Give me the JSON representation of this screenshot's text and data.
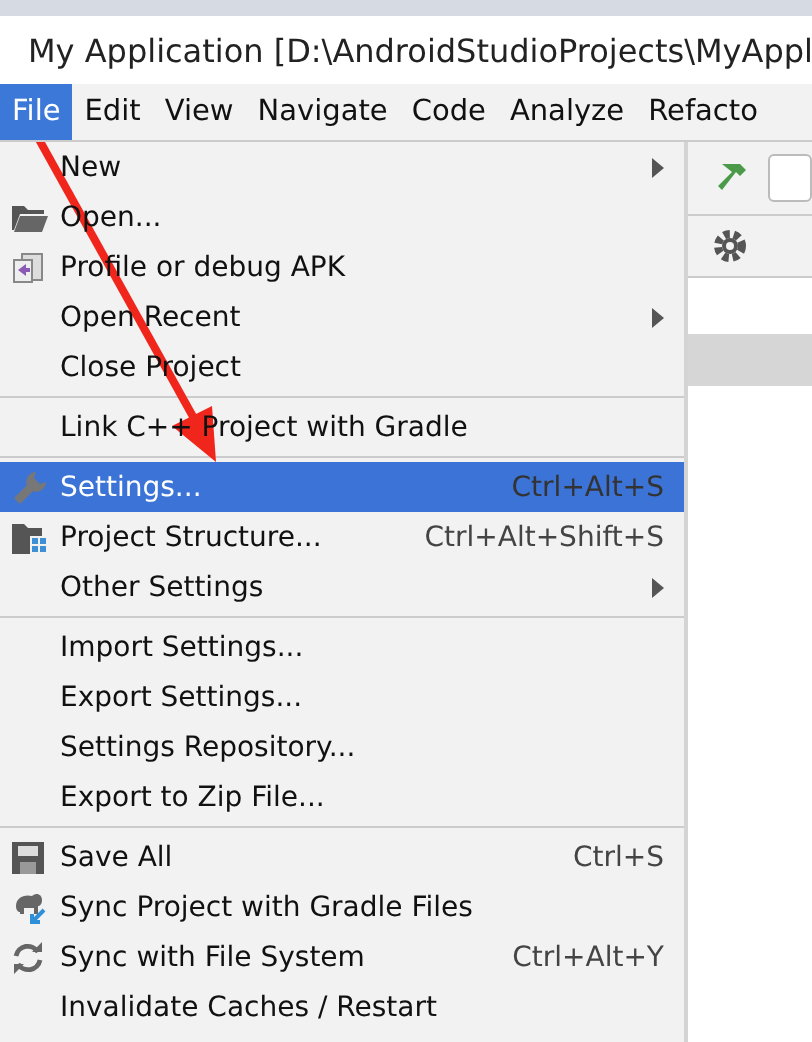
{
  "window": {
    "title": "My Application [D:\\AndroidStudioProjects\\MyAppl"
  },
  "menubar": [
    {
      "label": "File",
      "selected": true
    },
    {
      "label": "Edit",
      "selected": false
    },
    {
      "label": "View",
      "selected": false
    },
    {
      "label": "Navigate",
      "selected": false
    },
    {
      "label": "Code",
      "selected": false
    },
    {
      "label": "Analyze",
      "selected": false
    },
    {
      "label": "Refacto",
      "selected": false
    }
  ],
  "file_menu": [
    {
      "kind": "item",
      "label": "New",
      "submenu": true,
      "selected": false
    },
    {
      "kind": "item",
      "label": "Open...",
      "submenu": false,
      "selected": false
    },
    {
      "kind": "item",
      "label": "Profile or debug APK",
      "submenu": false,
      "selected": false
    },
    {
      "kind": "item",
      "label": "Open Recent",
      "submenu": true,
      "selected": false
    },
    {
      "kind": "item",
      "label": "Close Project",
      "submenu": false,
      "selected": false
    },
    {
      "kind": "separator"
    },
    {
      "kind": "item",
      "label": "Link C++ Project with Gradle",
      "submenu": false,
      "selected": false
    },
    {
      "kind": "separator"
    },
    {
      "kind": "item",
      "label": "Settings...",
      "shortcut": "Ctrl+Alt+S",
      "submenu": false,
      "selected": true
    },
    {
      "kind": "item",
      "label": "Project Structure...",
      "shortcut": "Ctrl+Alt+Shift+S",
      "submenu": false,
      "selected": false
    },
    {
      "kind": "item",
      "label": "Other Settings",
      "submenu": true,
      "selected": false
    },
    {
      "kind": "separator"
    },
    {
      "kind": "item",
      "label": "Import Settings...",
      "submenu": false,
      "selected": false
    },
    {
      "kind": "item",
      "label": "Export Settings...",
      "submenu": false,
      "selected": false
    },
    {
      "kind": "item",
      "label": "Settings Repository...",
      "submenu": false,
      "selected": false
    },
    {
      "kind": "item",
      "label": "Export to Zip File...",
      "submenu": false,
      "selected": false
    },
    {
      "kind": "separator"
    },
    {
      "kind": "item",
      "label": "Save All",
      "shortcut": "Ctrl+S",
      "submenu": false,
      "selected": false
    },
    {
      "kind": "item",
      "label": "Sync Project with Gradle Files",
      "submenu": false,
      "selected": false
    },
    {
      "kind": "item",
      "label": "Sync with File System",
      "shortcut": "Ctrl+Alt+Y",
      "submenu": false,
      "selected": false
    },
    {
      "kind": "item",
      "label": "Invalidate Caches / Restart",
      "submenu": false,
      "selected": false
    }
  ]
}
